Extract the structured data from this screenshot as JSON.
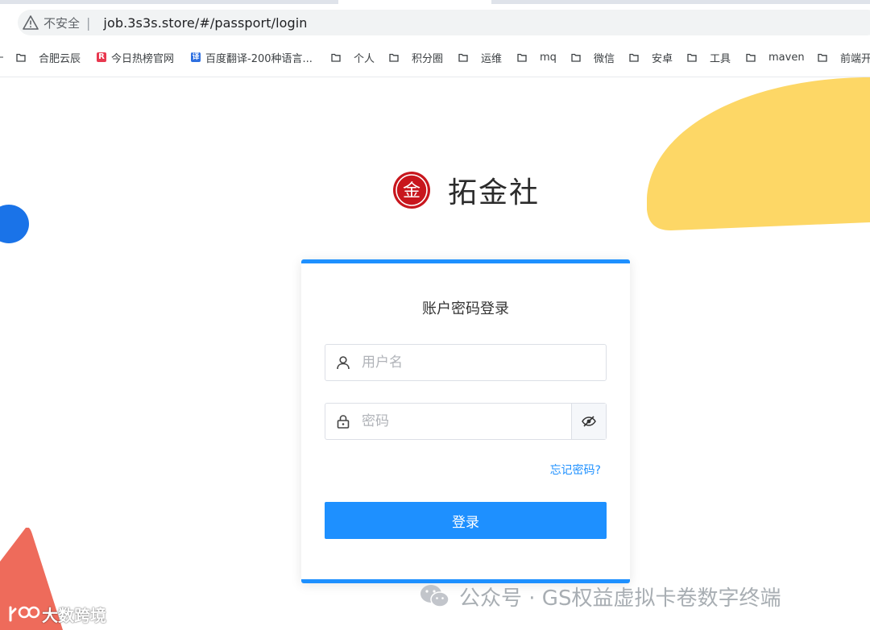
{
  "browser": {
    "security_label": "不安全",
    "separator": "|",
    "url": "job.3s3s.store/#/passport/login"
  },
  "bookmarks": [
    {
      "label": "合肥云辰",
      "icon": "folder-icon"
    },
    {
      "label": "今日热榜官网",
      "icon": "favicon-r"
    },
    {
      "label": "百度翻译-200种语言...",
      "icon": "favicon-translate"
    },
    {
      "label": "个人",
      "icon": "folder-icon"
    },
    {
      "label": "积分圈",
      "icon": "folder-icon"
    },
    {
      "label": "运维",
      "icon": "folder-icon"
    },
    {
      "label": "mq",
      "icon": "folder-icon"
    },
    {
      "label": "微信",
      "icon": "folder-icon"
    },
    {
      "label": "安卓",
      "icon": "folder-icon"
    },
    {
      "label": "工具",
      "icon": "folder-icon"
    },
    {
      "label": "maven",
      "icon": "folder-icon"
    },
    {
      "label": "前端开",
      "icon": "folder-icon"
    }
  ],
  "favicons": {
    "r_letter": "R",
    "translate_char": "译"
  },
  "logo": {
    "emblem_char": "金",
    "name": "拓金社"
  },
  "login": {
    "title": "账户密码登录",
    "username_placeholder": "用户名",
    "password_placeholder": "密码",
    "forgot_password": "忘记密码?",
    "submit_label": "登录"
  },
  "watermarks": {
    "wechat_text": "公众号 · GS权益虚拟卡卷数字终端",
    "brand_text": "大数跨境"
  },
  "colors": {
    "accent": "#1e90ff",
    "logo_red": "#c8161d",
    "deco_yellow": "#fdd766",
    "deco_blue": "#1a73e8",
    "deco_red": "#ee6b5b"
  }
}
